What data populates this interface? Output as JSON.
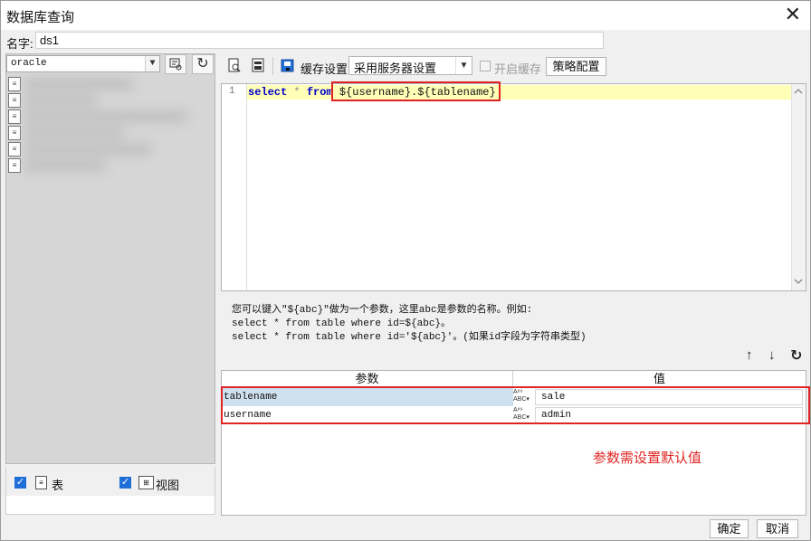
{
  "window": {
    "title": "数据库查询",
    "close_glyph": "✕"
  },
  "name_field": {
    "label": "名字:",
    "value": "ds1"
  },
  "left": {
    "db_select": "oracle",
    "db_select_arrow": "▼",
    "refresh_glyph": "↻",
    "filter_glyph": "⇪",
    "table_check_label": "表",
    "view_check_label": "视图",
    "check_mark": "✓"
  },
  "toolbar": {
    "cache_label": "缓存设置",
    "cache_select": "采用服务器设置",
    "enable_cache_label": "开启缓存",
    "strategy_button": "策略配置"
  },
  "editor": {
    "line_number": "1",
    "code": {
      "kw_select": "select",
      "star": " * ",
      "kw_from": "from",
      "space": " ",
      "params": "${username}.${tablename}"
    }
  },
  "hint": {
    "line1": "您可以键入\"${abc}\"做为一个参数，这里abc是参数的名称。例如:",
    "line2": "select * from table where id=${abc}。",
    "line3": "select * from table where id='${abc}'。(如果id字段为字符串类型)"
  },
  "param_toolbar": {
    "up": "↑",
    "down": "↓",
    "refresh": "↻"
  },
  "param_table": {
    "headers": [
      "参数",
      "值"
    ],
    "type_label": "A⁸⁹ABC",
    "rows": [
      {
        "name": "tablename",
        "value": "sale"
      },
      {
        "name": "username",
        "value": "admin"
      }
    ]
  },
  "annotation": "参数需设置默认值",
  "footer": {
    "ok": "确定",
    "cancel": "取消"
  },
  "colors": {
    "annotation_red": "#e02424",
    "selected_row": "#cfe0ee",
    "check_blue": "#1f6fd8"
  }
}
